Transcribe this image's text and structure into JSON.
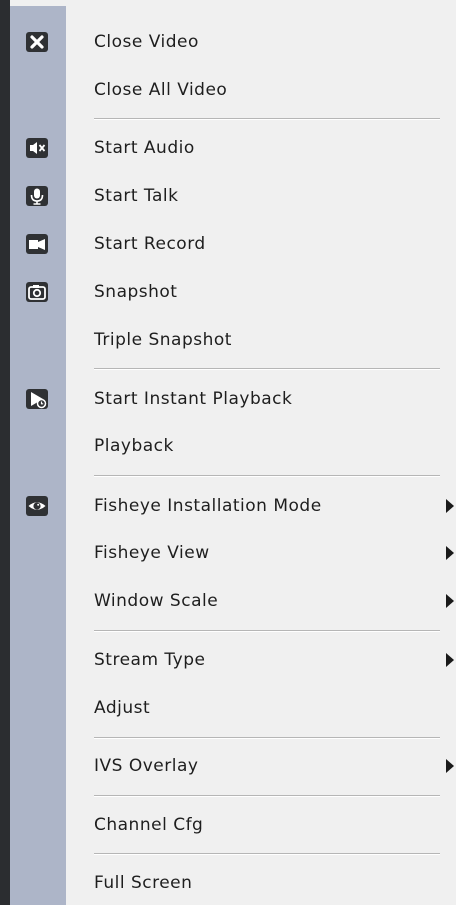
{
  "menu": {
    "items": [
      {
        "label": "Close Video",
        "icon": "close-icon",
        "submenu": false
      },
      {
        "label": "Close All Video",
        "icon": "",
        "submenu": false
      },
      {
        "label": "Start Audio",
        "icon": "speaker-muted-icon",
        "submenu": false
      },
      {
        "label": "Start Talk",
        "icon": "microphone-icon",
        "submenu": false
      },
      {
        "label": "Start Record",
        "icon": "video-camera-icon",
        "submenu": false
      },
      {
        "label": "Snapshot",
        "icon": "camera-icon",
        "submenu": false
      },
      {
        "label": "Triple Snapshot",
        "icon": "",
        "submenu": false
      },
      {
        "label": "Start Instant Playback",
        "icon": "instant-playback-icon",
        "submenu": false
      },
      {
        "label": "Playback",
        "icon": "",
        "submenu": false
      },
      {
        "label": "Fisheye Installation Mode",
        "icon": "eye-icon",
        "submenu": true
      },
      {
        "label": "Fisheye View",
        "icon": "",
        "submenu": true
      },
      {
        "label": "Window Scale",
        "icon": "",
        "submenu": true
      },
      {
        "label": "Stream Type",
        "icon": "",
        "submenu": true
      },
      {
        "label": "Adjust",
        "icon": "",
        "submenu": false
      },
      {
        "label": "IVS Overlay",
        "icon": "",
        "submenu": true
      },
      {
        "label": "Channel Cfg",
        "icon": "",
        "submenu": false
      },
      {
        "label": "Full Screen",
        "icon": "",
        "submenu": false
      }
    ]
  },
  "colors": {
    "menu_background": "#f0f0f0",
    "icon_gutter": "#adb5c8",
    "icon_fill": "#2f3134",
    "text": "#1e1e1e"
  }
}
